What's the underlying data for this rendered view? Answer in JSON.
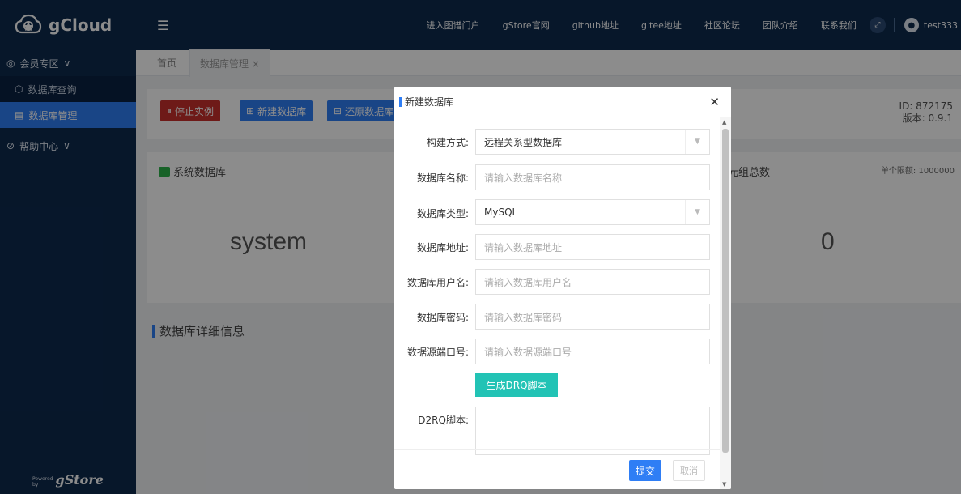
{
  "sidebar": {
    "logo_text": "gCloud",
    "group_member": "会员专区",
    "items": [
      {
        "label": "数据库查询"
      },
      {
        "label": "数据库管理"
      }
    ],
    "group_help": "帮助中心",
    "powered_small_1": "Powered",
    "powered_small_2": "by",
    "powered_brand": "gStore"
  },
  "header": {
    "links": [
      "进入图谱门户",
      "gStore官网",
      "github地址",
      "gitee地址",
      "社区论坛",
      "团队介绍",
      "联系我们"
    ],
    "username": "test333"
  },
  "tabs": {
    "home": "首页",
    "current": "数据库管理",
    "close": "×"
  },
  "toolbar": {
    "stop_label": "停止实例",
    "new_label": "新建数据库",
    "restore_label": "还原数据库",
    "id_text": "ID: 872175",
    "version_text": "版本: 0.9.1"
  },
  "cards": {
    "system_title": "系统数据库",
    "system_value": "system",
    "triples_title": "三元组总数",
    "triples_limit": "单个限额: 1000000",
    "triples_value": "0"
  },
  "section": {
    "detail_title": "数据库详细信息"
  },
  "modal": {
    "title": "新建数据库",
    "fields": {
      "build_label": "构建方式:",
      "build_value": "远程关系型数据库",
      "name_label": "数据库名称:",
      "name_placeholder": "请输入数据库名称",
      "type_label": "数据库类型:",
      "type_value": "MySQL",
      "address_label": "数据库地址:",
      "address_placeholder": "请输入数据库地址",
      "user_label": "数据库用户名:",
      "user_placeholder": "请输入数据库用户名",
      "password_label": "数据库密码:",
      "password_placeholder": "请输入数据库密码",
      "port_label": "数据源端口号:",
      "port_placeholder": "请输入数据源端口号",
      "gen_button": "生成DRQ脚本",
      "script_label": "D2RQ脚本:"
    },
    "submit": "提交",
    "cancel": "取消"
  },
  "colors": {
    "sidebar_bg": "#0d2a4e",
    "accent_blue": "#2f7ef5",
    "danger_red": "#c9302c",
    "teal": "#22c3b5"
  }
}
